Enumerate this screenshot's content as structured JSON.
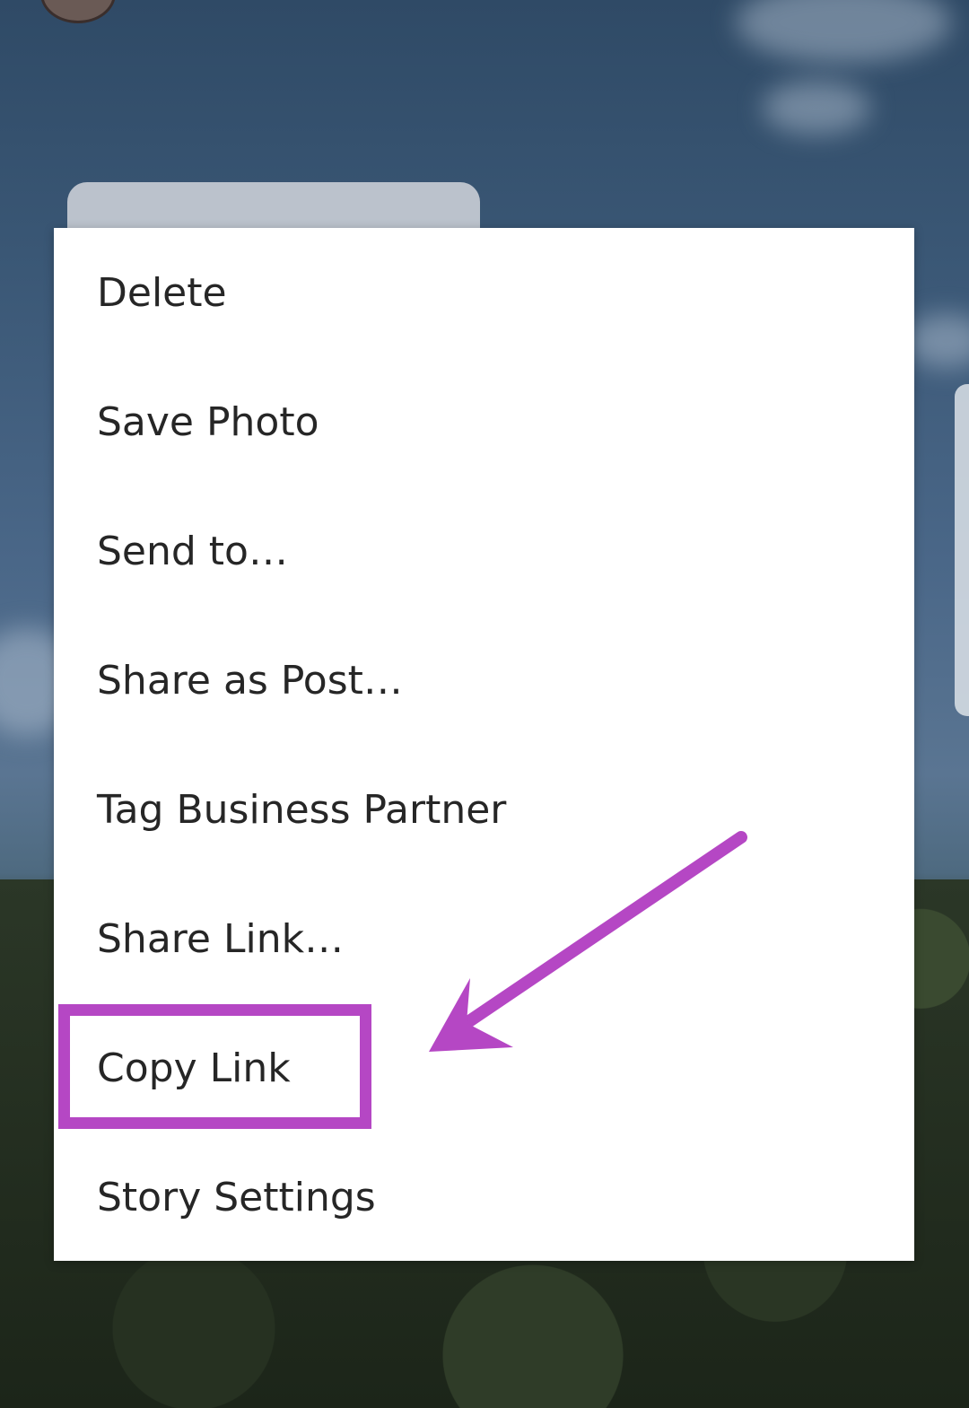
{
  "menu": {
    "items": [
      {
        "label": "Delete"
      },
      {
        "label": "Save Photo"
      },
      {
        "label": "Send to…"
      },
      {
        "label": "Share as Post…"
      },
      {
        "label": "Tag Business Partner"
      },
      {
        "label": "Share Link…"
      },
      {
        "label": "Copy Link"
      },
      {
        "label": "Story Settings"
      }
    ]
  },
  "annotation": {
    "highlighted_item": "Copy Link",
    "color": "#b547c4"
  },
  "colors": {
    "menu_background": "#ffffff",
    "menu_text": "#262626"
  }
}
